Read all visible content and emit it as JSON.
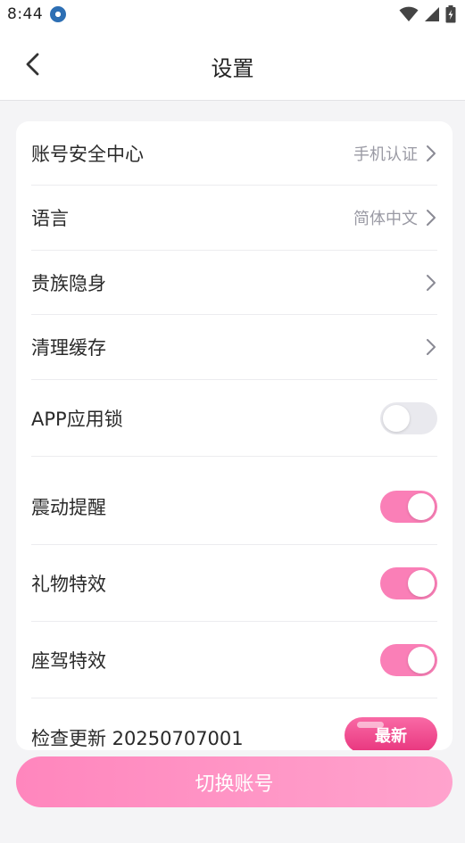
{
  "status_bar": {
    "time": "8:44"
  },
  "header": {
    "title": "设置"
  },
  "settings": {
    "account_security": {
      "label": "账号安全中心",
      "value": "手机认证"
    },
    "language": {
      "label": "语言",
      "value": "简体中文"
    },
    "noble_stealth": {
      "label": "贵族隐身"
    },
    "clear_cache": {
      "label": "清理缓存"
    },
    "app_lock": {
      "label": "APP应用锁",
      "enabled": false
    },
    "vibration": {
      "label": "震动提醒",
      "enabled": true
    },
    "gift_effects": {
      "label": "礼物特效",
      "enabled": true
    },
    "mount_effects": {
      "label": "座驾特效",
      "enabled": true
    },
    "check_update": {
      "label": "检查更新 20250707001",
      "badge": "最新"
    }
  },
  "footer": {
    "switch_account_label": "切换账号"
  },
  "colors": {
    "accent_pink": "#fa7fb7",
    "toggle_off": "#e9e9ee",
    "badge_pink": "#e8357d"
  }
}
